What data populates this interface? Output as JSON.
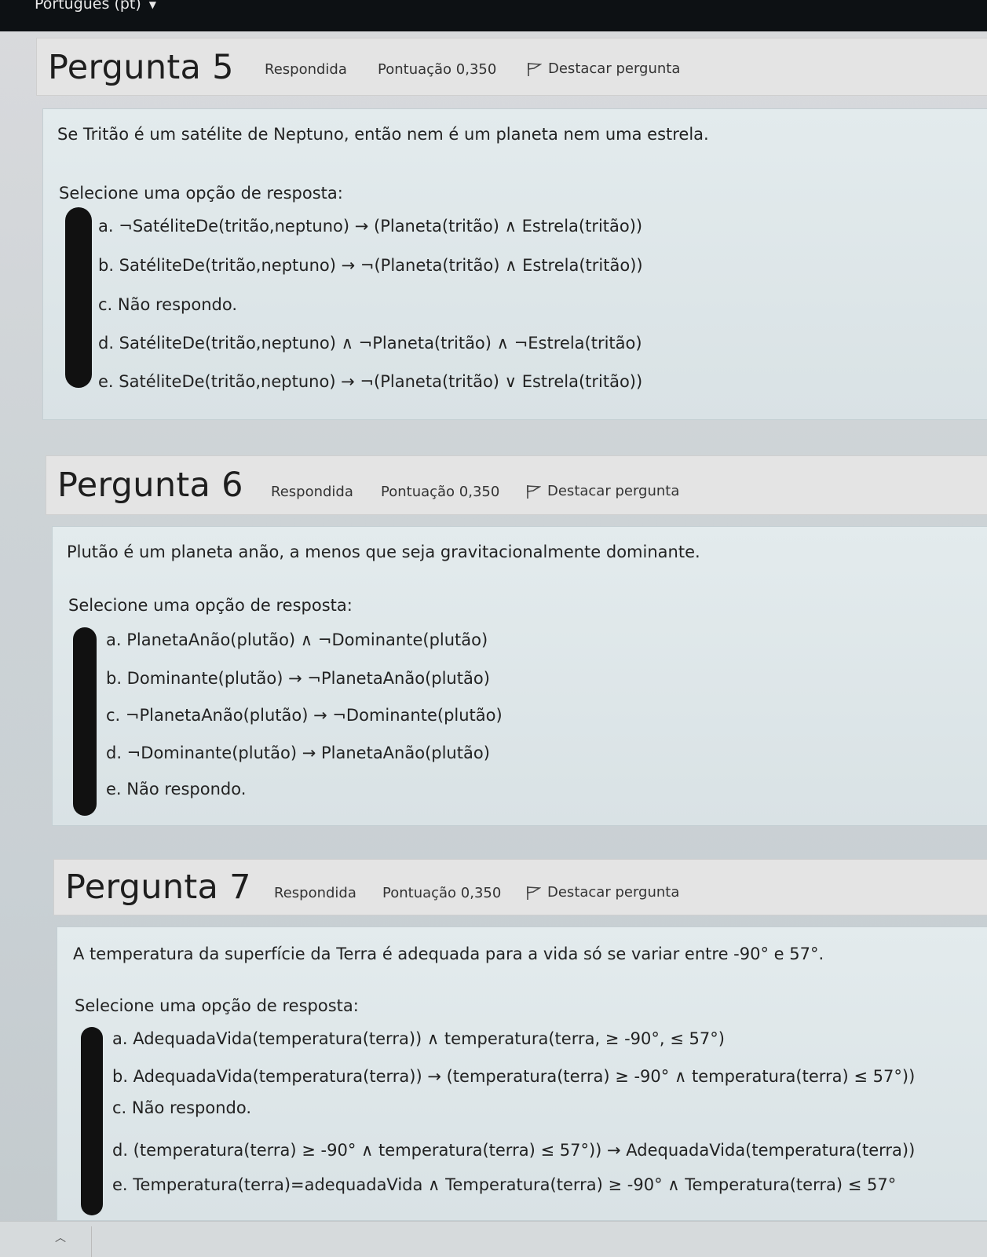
{
  "topbar": {
    "language": "Português (pt)"
  },
  "questions": [
    {
      "title": "Pergunta 5",
      "status": "Respondida",
      "score": "Pontuação 0,350",
      "flag_label": "Destacar pergunta",
      "text": "Se Tritão é um satélite de Neptuno, então nem é um planeta nem uma estrela.",
      "prompt": "Selecione uma opção de resposta:",
      "options": [
        "a. ¬SatéliteDe(tritão,neptuno) → (Planeta(tritão) ∧ Estrela(tritão))",
        "b. SatéliteDe(tritão,neptuno) → ¬(Planeta(tritão) ∧ Estrela(tritão))",
        "c. Não respondo.",
        "d. SatéliteDe(tritão,neptuno) ∧ ¬Planeta(tritão) ∧ ¬Estrela(tritão)",
        "e. SatéliteDe(tritão,neptuno) → ¬(Planeta(tritão) ∨ Estrela(tritão))"
      ]
    },
    {
      "title": "Pergunta 6",
      "status": "Respondida",
      "score": "Pontuação 0,350",
      "flag_label": "Destacar pergunta",
      "text": "Plutão é um planeta anão, a menos que seja gravitacionalmente dominante.",
      "prompt": "Selecione uma opção de resposta:",
      "options": [
        "a. PlanetaAnão(plutão) ∧ ¬Dominante(plutão)",
        "b. Dominante(plutão) → ¬PlanetaAnão(plutão)",
        "c. ¬PlanetaAnão(plutão) → ¬Dominante(plutão)",
        "d. ¬Dominante(plutão) → PlanetaAnão(plutão)",
        "e. Não respondo."
      ]
    },
    {
      "title": "Pergunta 7",
      "status": "Respondida",
      "score": "Pontuação 0,350",
      "flag_label": "Destacar pergunta",
      "text": "A temperatura da superfície da Terra é adequada para a vida só se variar entre -90° e 57°.",
      "prompt": "Selecione uma opção de resposta:",
      "options": [
        "a. AdequadaVida(temperatura(terra)) ∧ temperatura(terra, ≥ -90°,  ≤ 57°)",
        "b. AdequadaVida(temperatura(terra)) → (temperatura(terra) ≥ -90° ∧ temperatura(terra) ≤ 57°))",
        "c. Não respondo.",
        "d. (temperatura(terra) ≥ -90° ∧ temperatura(terra) ≤ 57°)) → AdequadaVida(temperatura(terra))",
        "e. Temperatura(terra)=adequadaVida ∧ Temperatura(terra) ≥ -90° ∧ Temperatura(terra) ≤ 57°"
      ]
    }
  ]
}
